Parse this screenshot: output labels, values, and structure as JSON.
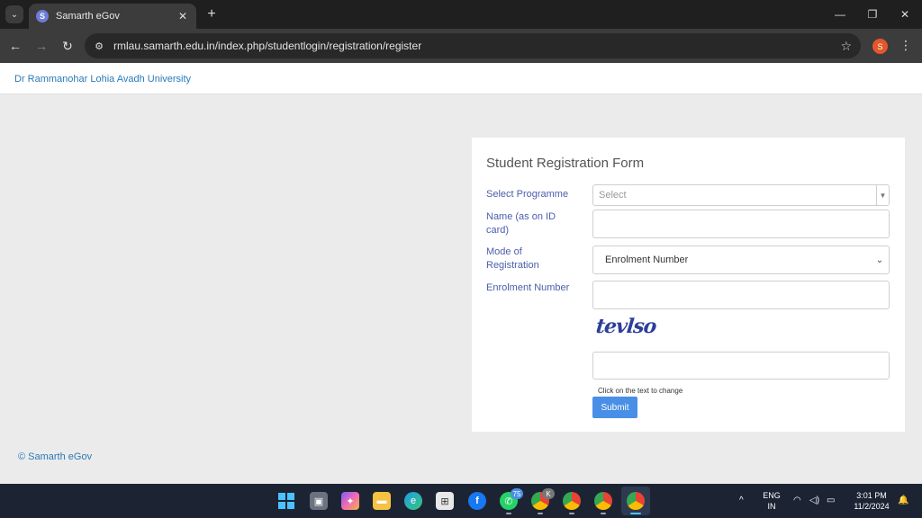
{
  "browser": {
    "tab_title": "Samarth eGov",
    "tab_favicon_letter": "S",
    "url": "rmlau.samarth.edu.in/index.php/studentlogin/registration/register",
    "profile_letter": "S"
  },
  "page": {
    "brand": "Dr Rammanohar Lohia Avadh University",
    "footer": "© Samarth eGov"
  },
  "form": {
    "title": "Student Registration Form",
    "programme_label": "Select Programme",
    "programme_placeholder": "Select",
    "name_label_line1": "Name (as on ID",
    "name_label_line2": "card)",
    "mode_label_line1": "Mode of",
    "mode_label_line2": "Registration",
    "mode_value": "Enrolment Number",
    "enrolment_label": "Enrolment Number",
    "captcha_text": "tevlso",
    "captcha_hint": "Click on the text to change",
    "submit_label": "Submit"
  },
  "taskbar": {
    "whatsapp_badge": "75",
    "chrome_k_badge": "K",
    "lang_line1": "ENG",
    "lang_line2": "IN",
    "time": "3:01 PM",
    "date": "11/2/2024"
  },
  "colors": {
    "accent": "#4a8fe7",
    "link": "#2a7ab8",
    "label": "#4b5eaa",
    "captcha": "#2c3f9a"
  }
}
